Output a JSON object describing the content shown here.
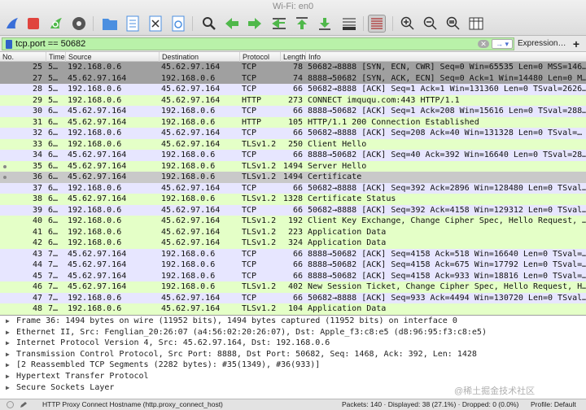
{
  "window": {
    "title": "Wi-Fi: en0"
  },
  "toolbar": {
    "buttons": [
      "shark-fin-start-icon",
      "stop-capture-icon",
      "restart-capture-icon",
      "capture-options-icon",
      "open-file-icon",
      "save-file-icon",
      "close-file-icon",
      "reload-file-icon",
      "find-packet-icon",
      "go-back-icon",
      "go-forward-icon",
      "go-to-packet-icon",
      "go-first-icon",
      "go-last-icon",
      "auto-scroll-icon",
      "colorize-icon",
      "zoom-in-icon",
      "zoom-out-icon",
      "zoom-normal-icon",
      "resize-columns-icon"
    ]
  },
  "filter": {
    "value": "tcp.port == 50682",
    "expression_label": "Expression…",
    "plus_label": "+",
    "clear_glyph": "✕",
    "apply_glyph": "→ ▾"
  },
  "columns": {
    "no": "No.",
    "time": "Time",
    "source": "Source",
    "destination": "Destination",
    "protocol": "Protocol",
    "length": "Length",
    "info": "Info"
  },
  "packets": [
    {
      "no": "25",
      "time": "5…",
      "src": "192.168.0.6",
      "dst": "45.62.97.164",
      "proto": "TCP",
      "len": "78",
      "info": "50682→8888 [SYN, ECN, CWR] Seq=0 Win=65535 Len=0 MSS=146…",
      "kind": "bad"
    },
    {
      "no": "27",
      "time": "5…",
      "src": "45.62.97.164",
      "dst": "192.168.0.6",
      "proto": "TCP",
      "len": "74",
      "info": "8888→50682 [SYN, ACK, ECN] Seq=0 Ack=1 Win=14480 Len=0 M…",
      "kind": "bad"
    },
    {
      "no": "28",
      "time": "5…",
      "src": "192.168.0.6",
      "dst": "45.62.97.164",
      "proto": "TCP",
      "len": "66",
      "info": "50682→8888 [ACK] Seq=1 Ack=1 Win=131360 Len=0 TSval=2626…",
      "kind": "tcp"
    },
    {
      "no": "29",
      "time": "5…",
      "src": "192.168.0.6",
      "dst": "45.62.97.164",
      "proto": "HTTP",
      "len": "273",
      "info": "CONNECT imququ.com:443 HTTP/1.1",
      "kind": "http"
    },
    {
      "no": "30",
      "time": "6…",
      "src": "45.62.97.164",
      "dst": "192.168.0.6",
      "proto": "TCP",
      "len": "66",
      "info": "8888→50682 [ACK] Seq=1 Ack=208 Win=15616 Len=0 TSval=288…",
      "kind": "tcp"
    },
    {
      "no": "31",
      "time": "6…",
      "src": "45.62.97.164",
      "dst": "192.168.0.6",
      "proto": "HTTP",
      "len": "105",
      "info": "HTTP/1.1 200 Connection Established",
      "kind": "http"
    },
    {
      "no": "32",
      "time": "6…",
      "src": "192.168.0.6",
      "dst": "45.62.97.164",
      "proto": "TCP",
      "len": "66",
      "info": "50682→8888 [ACK] Seq=208 Ack=40 Win=131328 Len=0 TSval=…",
      "kind": "tcp"
    },
    {
      "no": "33",
      "time": "6…",
      "src": "192.168.0.6",
      "dst": "45.62.97.164",
      "proto": "TLSv1.2",
      "len": "250",
      "info": "Client Hello",
      "kind": "tls"
    },
    {
      "no": "34",
      "time": "6…",
      "src": "45.62.97.164",
      "dst": "192.168.0.6",
      "proto": "TCP",
      "len": "66",
      "info": "8888→50682 [ACK] Seq=40 Ack=392 Win=16640 Len=0 TSval=28…",
      "kind": "tcp"
    },
    {
      "no": "35",
      "time": "6…",
      "src": "45.62.97.164",
      "dst": "192.168.0.6",
      "proto": "TLSv1.2",
      "len": "1494",
      "info": "Server Hello",
      "kind": "tls",
      "mark": true
    },
    {
      "no": "36",
      "time": "6…",
      "src": "45.62.97.164",
      "dst": "192.168.0.6",
      "proto": "TLSv1.2",
      "len": "1494",
      "info": "Certificate",
      "kind": "selected",
      "mark": true
    },
    {
      "no": "37",
      "time": "6…",
      "src": "192.168.0.6",
      "dst": "45.62.97.164",
      "proto": "TCP",
      "len": "66",
      "info": "50682→8888 [ACK] Seq=392 Ack=2896 Win=128480 Len=0 TSval…",
      "kind": "tcp"
    },
    {
      "no": "38",
      "time": "6…",
      "src": "45.62.97.164",
      "dst": "192.168.0.6",
      "proto": "TLSv1.2",
      "len": "1328",
      "info": "Certificate Status",
      "kind": "tls"
    },
    {
      "no": "39",
      "time": "6…",
      "src": "192.168.0.6",
      "dst": "45.62.97.164",
      "proto": "TCP",
      "len": "66",
      "info": "50682→8888 [ACK] Seq=392 Ack=4158 Win=129312 Len=0 TSval…",
      "kind": "tcp"
    },
    {
      "no": "40",
      "time": "6…",
      "src": "192.168.0.6",
      "dst": "45.62.97.164",
      "proto": "TLSv1.2",
      "len": "192",
      "info": "Client Key Exchange, Change Cipher Spec, Hello Request, …",
      "kind": "tls"
    },
    {
      "no": "41",
      "time": "6…",
      "src": "192.168.0.6",
      "dst": "45.62.97.164",
      "proto": "TLSv1.2",
      "len": "223",
      "info": "Application Data",
      "kind": "tls"
    },
    {
      "no": "42",
      "time": "6…",
      "src": "192.168.0.6",
      "dst": "45.62.97.164",
      "proto": "TLSv1.2",
      "len": "324",
      "info": "Application Data",
      "kind": "tls"
    },
    {
      "no": "43",
      "time": "7…",
      "src": "45.62.97.164",
      "dst": "192.168.0.6",
      "proto": "TCP",
      "len": "66",
      "info": "8888→50682 [ACK] Seq=4158 Ack=518 Win=16640 Len=0 TSval=…",
      "kind": "tcp"
    },
    {
      "no": "44",
      "time": "7…",
      "src": "45.62.97.164",
      "dst": "192.168.0.6",
      "proto": "TCP",
      "len": "66",
      "info": "8888→50682 [ACK] Seq=4158 Ack=675 Win=17792 Len=0 TSval=…",
      "kind": "tcp"
    },
    {
      "no": "45",
      "time": "7…",
      "src": "45.62.97.164",
      "dst": "192.168.0.6",
      "proto": "TCP",
      "len": "66",
      "info": "8888→50682 [ACK] Seq=4158 Ack=933 Win=18816 Len=0 TSval=…",
      "kind": "tcp"
    },
    {
      "no": "46",
      "time": "7…",
      "src": "45.62.97.164",
      "dst": "192.168.0.6",
      "proto": "TLSv1.2",
      "len": "402",
      "info": "New Session Ticket, Change Cipher Spec, Hello Request, H…",
      "kind": "tls"
    },
    {
      "no": "47",
      "time": "7…",
      "src": "192.168.0.6",
      "dst": "45.62.97.164",
      "proto": "TCP",
      "len": "66",
      "info": "50682→8888 [ACK] Seq=933 Ack=4494 Win=130720 Len=0 TSval…",
      "kind": "tcp"
    },
    {
      "no": "48",
      "time": "7…",
      "src": "192.168.0.6",
      "dst": "45.62.97.164",
      "proto": "TLSv1.2",
      "len": "104",
      "info": "Application Data",
      "kind": "tls"
    }
  ],
  "details": [
    {
      "arrow": "▶",
      "text": "Frame 36: 1494 bytes on wire (11952 bits), 1494 bytes captured (11952 bits) on interface 0"
    },
    {
      "arrow": "▶",
      "text": "Ethernet II, Src: Fenglian_20:26:07 (a4:56:02:20:26:07), Dst: Apple_f3:c8:e5 (d8:96:95:f3:c8:e5)"
    },
    {
      "arrow": "▶",
      "text": "Internet Protocol Version 4, Src: 45.62.97.164, Dst: 192.168.0.6"
    },
    {
      "arrow": "▶",
      "text": "Transmission Control Protocol, Src Port: 8888, Dst Port: 50682, Seq: 1468, Ack: 392, Len: 1428"
    },
    {
      "arrow": "▶",
      "text": "[2 Reassembled TCP Segments (2282 bytes): #35(1349), #36(933)]"
    },
    {
      "arrow": "▶",
      "text": "Hypertext Transfer Protocol"
    },
    {
      "arrow": "▶",
      "text": "Secure Sockets Layer"
    }
  ],
  "status": {
    "field": "HTTP Proxy Connect Hostname (http.proxy_connect_host)",
    "packets": "Packets: 140 · Displayed: 38 (27.1%) · Dropped: 0 (0.0%)",
    "profile": "Profile: Default"
  },
  "watermark": "@稀土掘金技术社区",
  "colors": {
    "tcp_row": "#e7e6ff",
    "tls_row": "#e4ffc7",
    "bad_row": "#a0a0a0",
    "selected_row": "#c9c9c9",
    "filter_ok": "#b9f1a9"
  }
}
